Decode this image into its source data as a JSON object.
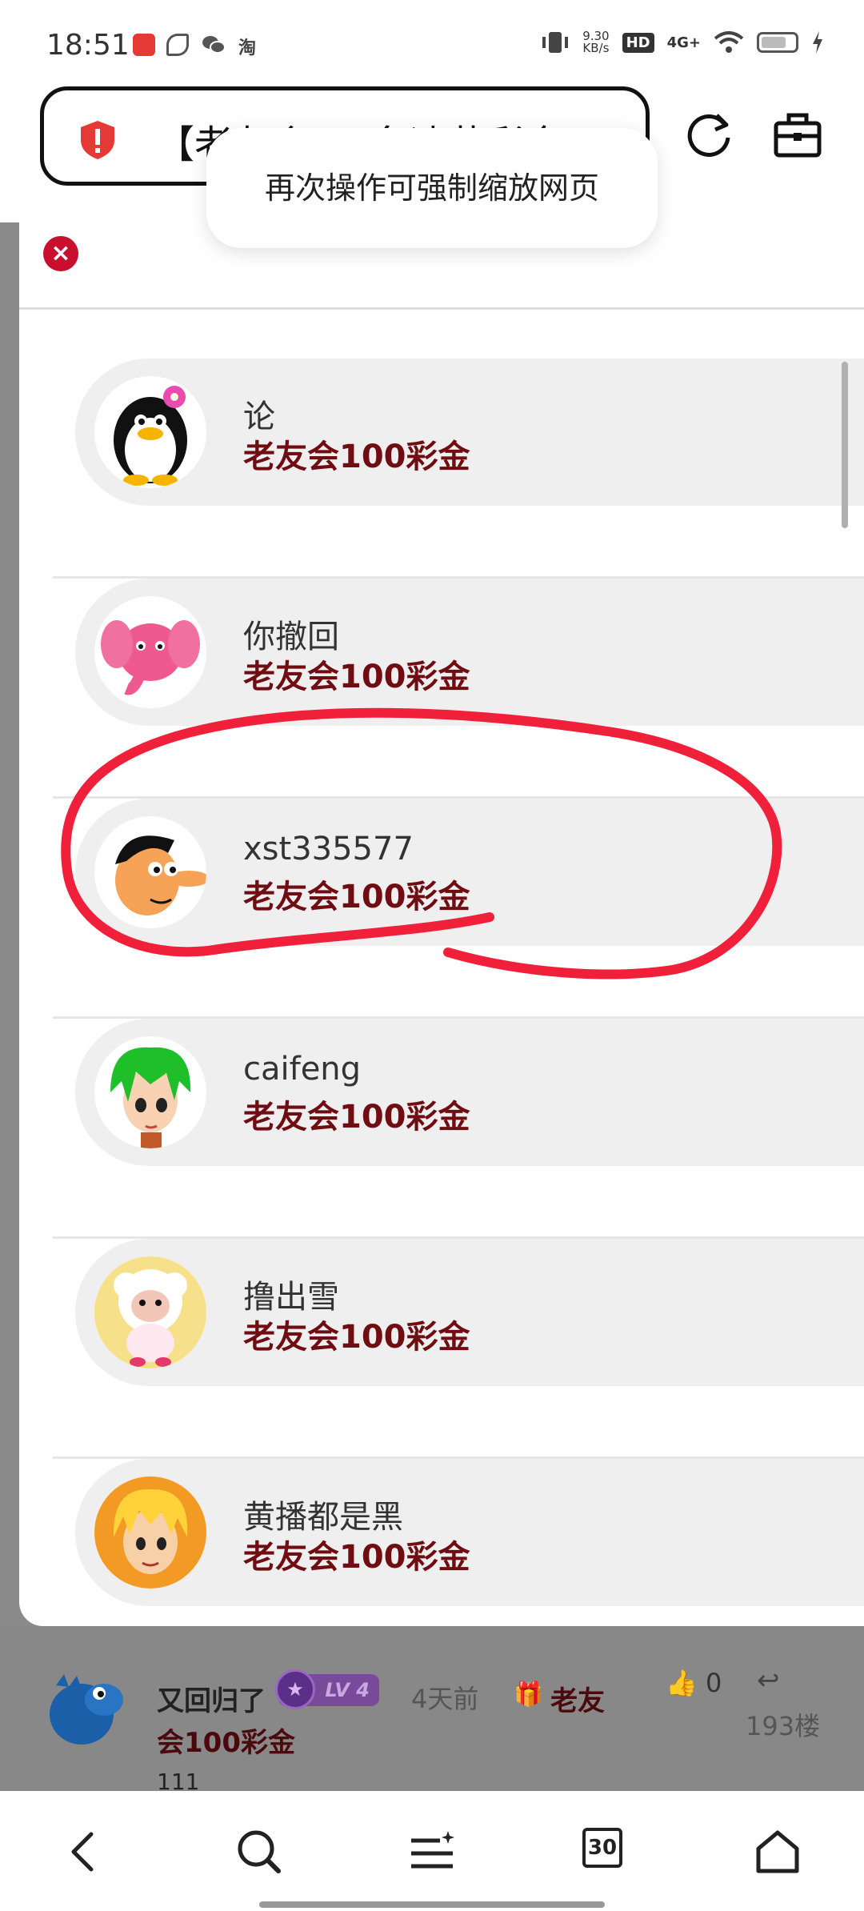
{
  "status_bar": {
    "time": "18:51",
    "net_speed": "9.30",
    "net_unit": "KB/s",
    "hd": "HD",
    "network": "4G+",
    "app_icons": [
      "app-icon-red",
      "app-icon-leaf",
      "wechat-icon",
      "taobao-icon"
    ],
    "taobao_label": "淘"
  },
  "browser": {
    "url_text": "【老友会 10名速获彩金",
    "toast": "再次操作可强制缩放网页"
  },
  "popup": {
    "items": [
      {
        "name": "论",
        "gift": "老友会100彩金",
        "avatar": "penguin-avatar"
      },
      {
        "name": "你撤回",
        "gift": "老友会100彩金",
        "avatar": "elephant-avatar"
      },
      {
        "name": "xst335577",
        "gift": "老友会100彩金",
        "avatar": "cartoon-boy-avatar"
      },
      {
        "name": "caifeng",
        "gift": "老友会100彩金",
        "avatar": "green-hair-avatar"
      },
      {
        "name": "撸出雪",
        "gift": "老友会100彩金",
        "avatar": "sheep-avatar"
      },
      {
        "name": "黄播都是黑",
        "gift": "老友会100彩金",
        "avatar": "blond-hair-avatar"
      }
    ]
  },
  "comment": {
    "name": "又回归了",
    "level": "LV 4",
    "time": "4天前",
    "gift_line1": "老友",
    "gift_line2": "会100彩金",
    "likes": "0",
    "floor": "193楼",
    "body": "111"
  },
  "bottom_nav": {
    "tabs_count": "30"
  },
  "colors": {
    "gift_text": "#6f0d12",
    "close_button": "#c8102e",
    "annotation": "#f0203a"
  }
}
